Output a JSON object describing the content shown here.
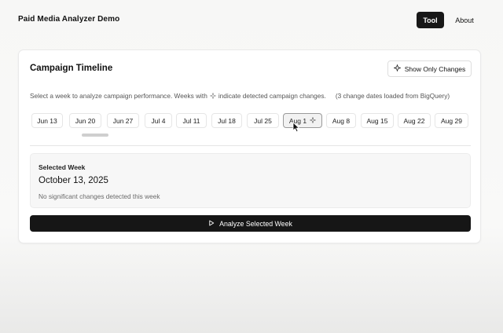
{
  "header": {
    "app_title": "Paid Media Analyzer Demo",
    "nav": [
      {
        "label": "Tool",
        "active": true
      },
      {
        "label": "About",
        "active": false
      }
    ]
  },
  "campaign_timeline": {
    "title": "Campaign Timeline",
    "toggle_button_label": "Show Only Changes",
    "toggle_icon": "sparkle-icon",
    "instructions_before": "Select a week to analyze campaign performance. Weeks with",
    "instructions_icon": "sparkle-icon",
    "instructions_after": "indicate detected campaign changes.",
    "load_status": "(3 change dates loaded from BigQuery)",
    "weeks": [
      {
        "label": "Jun 13",
        "has_change": false,
        "selected": false
      },
      {
        "label": "Jun 20",
        "has_change": false,
        "selected": false
      },
      {
        "label": "Jun 27",
        "has_change": false,
        "selected": false
      },
      {
        "label": "Jul 4",
        "has_change": false,
        "selected": false
      },
      {
        "label": "Jul 11",
        "has_change": false,
        "selected": false
      },
      {
        "label": "Jul 18",
        "has_change": false,
        "selected": false
      },
      {
        "label": "Jul 25",
        "has_change": false,
        "selected": false
      },
      {
        "label": "Aug 1",
        "has_change": true,
        "selected": false,
        "hovered": true
      },
      {
        "label": "Aug 8",
        "has_change": false,
        "selected": false
      },
      {
        "label": "Aug 15",
        "has_change": false,
        "selected": false
      },
      {
        "label": "Aug 22",
        "has_change": false,
        "selected": false
      },
      {
        "label": "Aug 29",
        "has_change": false,
        "selected": false
      }
    ]
  },
  "selected_week": {
    "label": "Selected Week",
    "date": "October 13, 2025",
    "note": "No significant changes detected this week"
  },
  "analyze_button": {
    "label": "Analyze Selected Week",
    "icon": "play-icon"
  },
  "colors": {
    "primary": "#161616",
    "background": "#f7f7f6",
    "card": "#ffffff"
  }
}
